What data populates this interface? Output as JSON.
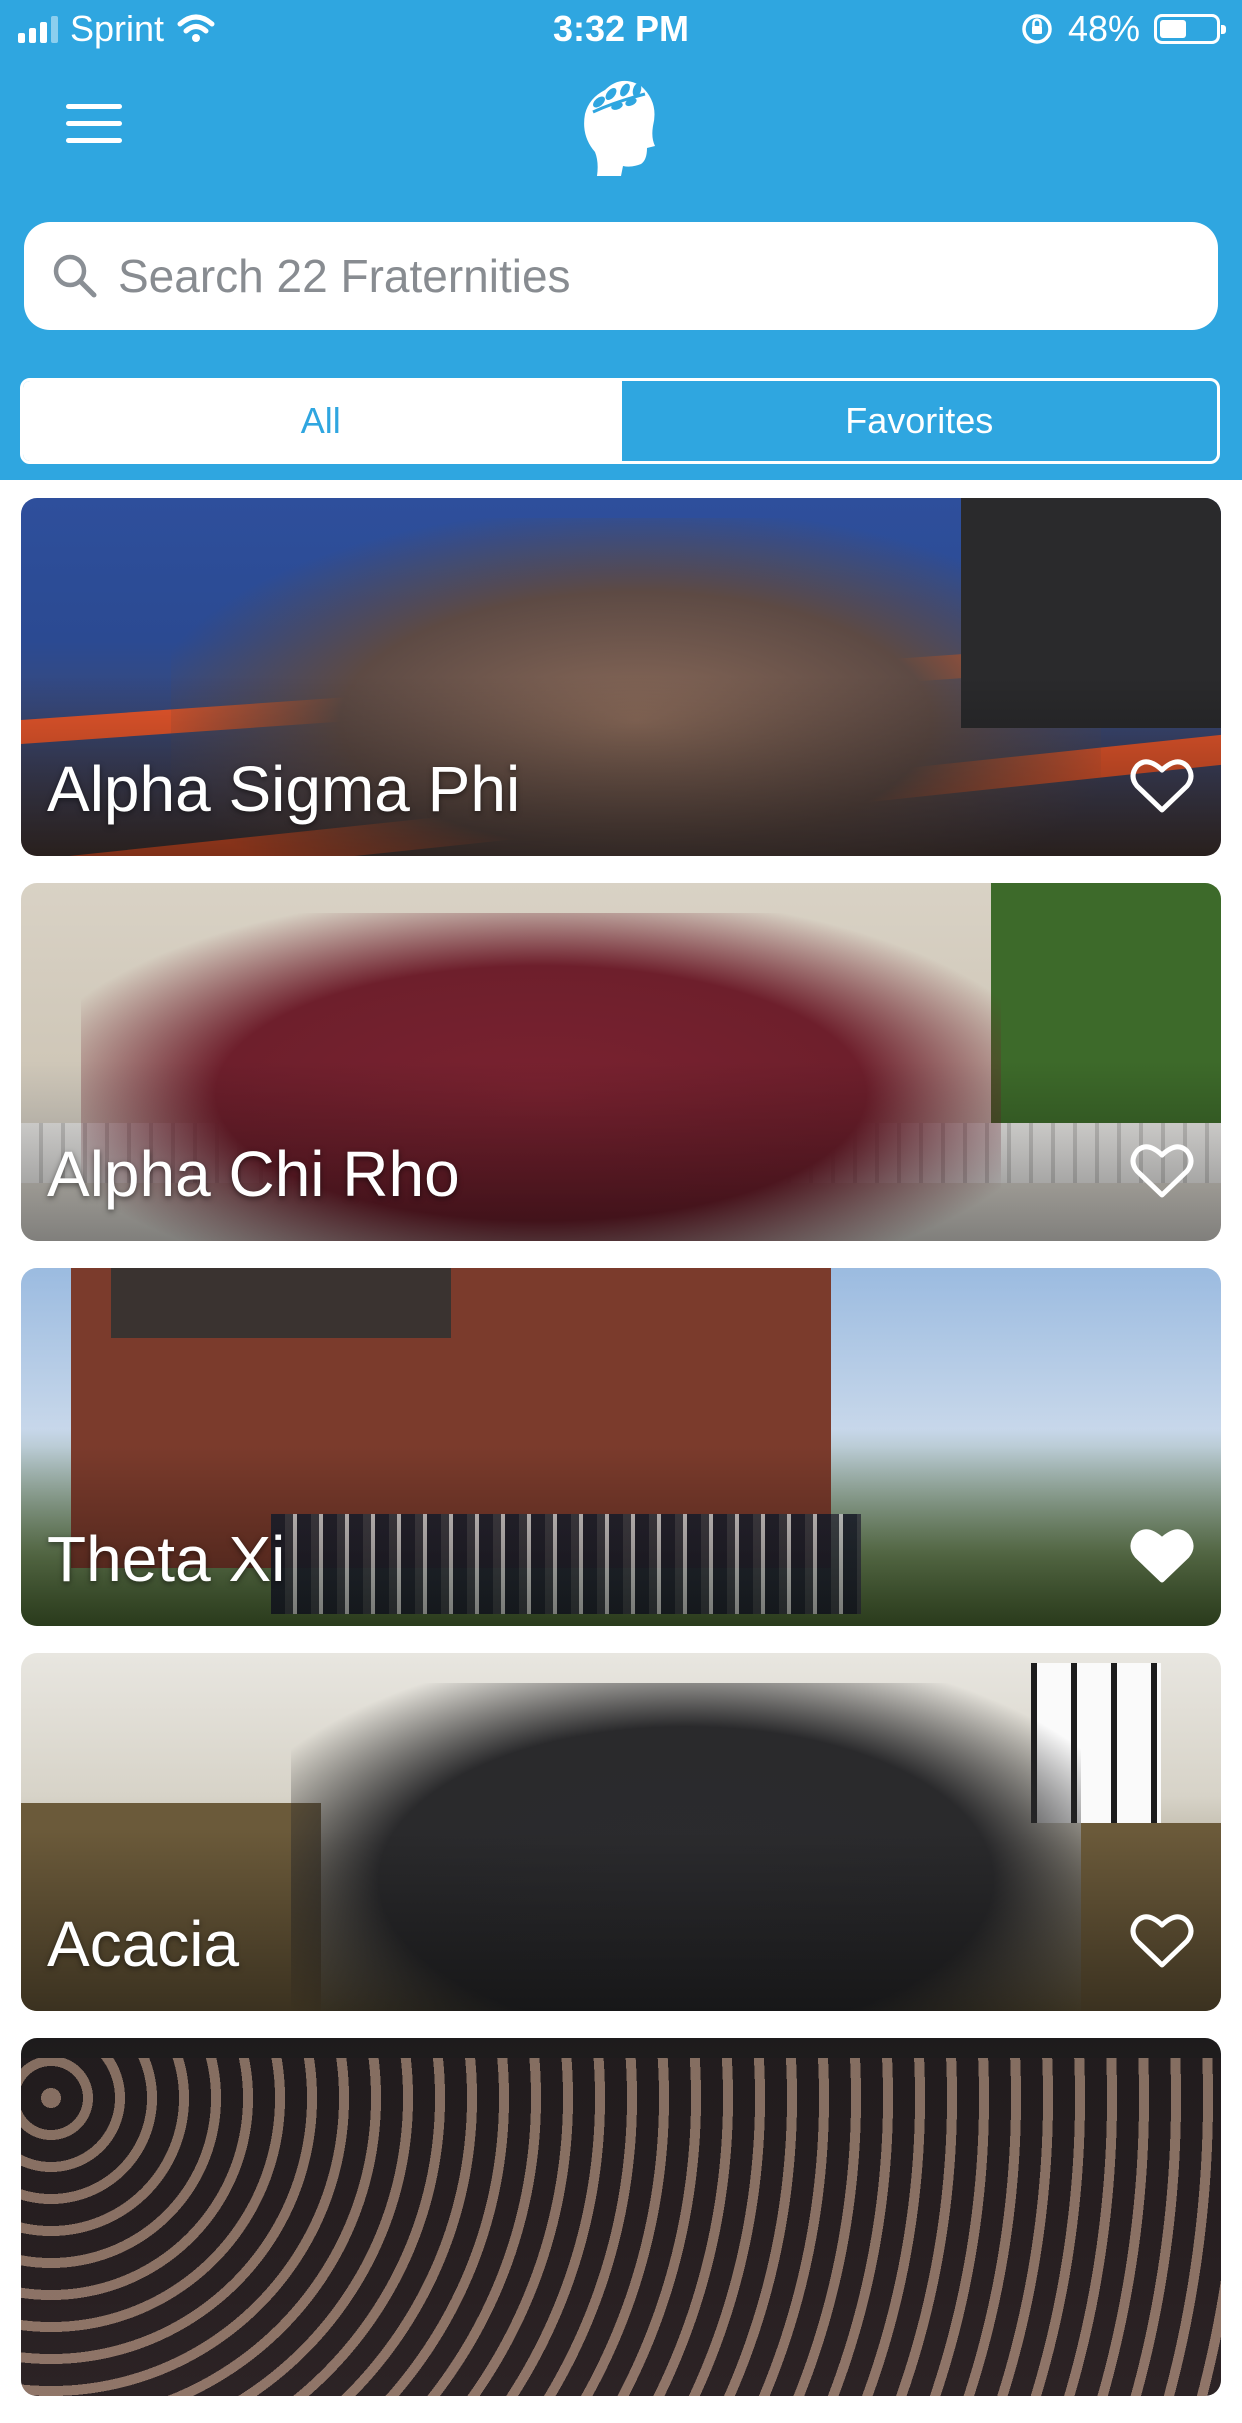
{
  "status_bar": {
    "carrier": "Sprint",
    "time": "3:32 PM",
    "battery": "48%",
    "battery_level": 0.48
  },
  "header": {
    "menu_icon": "hamburger-menu-icon",
    "logo_icon": "laurel-head-logo-icon"
  },
  "search": {
    "placeholder": "Search 22 Fraternities",
    "value": ""
  },
  "segments": [
    {
      "label": "All",
      "selected": true
    },
    {
      "label": "Favorites",
      "selected": false
    }
  ],
  "fraternities": [
    {
      "name": "Alpha Sigma Phi",
      "favorited": false
    },
    {
      "name": "Alpha Chi Rho",
      "favorited": false
    },
    {
      "name": "Theta Xi",
      "favorited": true
    },
    {
      "name": "Acacia",
      "favorited": false
    },
    {
      "name": "",
      "favorited": false
    }
  ],
  "colors": {
    "accent": "#2fa6e0",
    "header_text": "#ffffff"
  }
}
